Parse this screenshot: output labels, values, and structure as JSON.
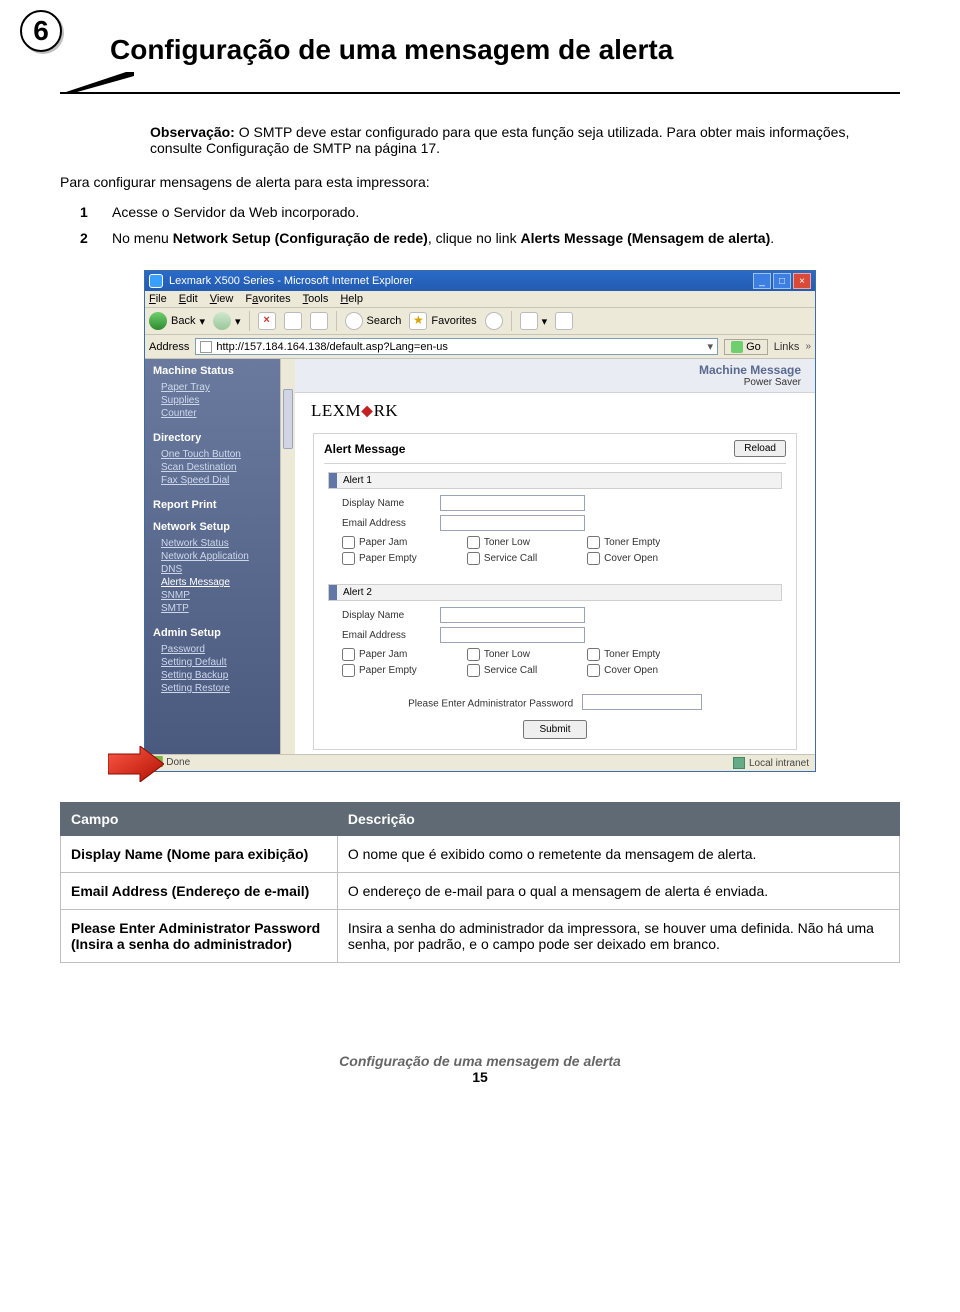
{
  "step_number": "6",
  "page_title": "Configuração de uma mensagem de alerta",
  "note": {
    "label": "Observação:",
    "text": "O SMTP deve estar configurado para que esta função seja utilizada. Para obter mais informações, consulte Configuração de SMTP na página 17."
  },
  "lead": "Para configurar mensagens de alerta para esta impressora:",
  "steps": [
    {
      "num": "1",
      "text": "Acesse o Servidor da Web incorporado."
    },
    {
      "num": "2",
      "text_pre": "No menu ",
      "bold1": "Network Setup (Configuração de rede)",
      "mid": ", clique no link ",
      "bold2": "Alerts Message (Mensagem de alerta)",
      "post": "."
    }
  ],
  "browser": {
    "title": "Lexmark X500 Series - Microsoft Internet Explorer",
    "menus": [
      "File",
      "Edit",
      "View",
      "Favorites",
      "Tools",
      "Help"
    ],
    "toolbar": {
      "back": "Back",
      "search": "Search",
      "favorites": "Favorites"
    },
    "address_label": "Address",
    "url": "http://157.184.164.138/default.asp?Lang=en-us",
    "go": "Go",
    "links": "Links",
    "machine_message": {
      "title": "Machine Message",
      "sub": "Power Saver"
    },
    "brand": "LEXMARK",
    "sidebar": {
      "machine_status": {
        "title": "Machine Status",
        "items": [
          "Paper Tray",
          "Supplies",
          "Counter"
        ]
      },
      "directory": {
        "title": "Directory",
        "items": [
          "One Touch Button",
          "Scan Destination",
          "Fax Speed Dial"
        ]
      },
      "report_print": {
        "title": "Report Print"
      },
      "network_setup": {
        "title": "Network Setup",
        "items": [
          "Network Status",
          "Network Application",
          "DNS",
          "Alerts Message",
          "SNMP",
          "SMTP"
        ]
      },
      "admin_setup": {
        "title": "Admin Setup",
        "items": [
          "Password",
          "Setting Default",
          "Setting Backup",
          "Setting Restore"
        ]
      }
    },
    "panel_title": "Alert Message",
    "reload": "Reload",
    "alert": {
      "group1": "Alert 1",
      "group2": "Alert 2",
      "display_name": "Display Name",
      "email": "Email Address",
      "c_paperjam": "Paper Jam",
      "c_paperempty": "Paper Empty",
      "c_tonerlow": "Toner Low",
      "c_servicecall": "Service Call",
      "c_tonerempty": "Toner Empty",
      "c_coveropen": "Cover Open",
      "admin_prompt": "Please Enter Administrator Password",
      "submit": "Submit"
    },
    "status_done": "Done",
    "status_zone": "Local intranet"
  },
  "table": {
    "col1": "Campo",
    "col2": "Descrição",
    "rows": [
      {
        "k": "Display Name (Nome para exibição)",
        "v": "O nome que é exibido como o remetente da mensagem de alerta."
      },
      {
        "k": "Email Address (Endereço de e-mail)",
        "v": "O endereço de e-mail para o qual a mensagem de alerta é enviada."
      },
      {
        "k": "Please Enter Administrator Password (Insira a senha do administrador)",
        "v": "Insira a senha do administrador da impressora, se houver uma definida. Não há uma senha, por padrão, e o campo pode ser deixado em branco."
      }
    ]
  },
  "footer_title": "Configuração de uma mensagem de alerta",
  "footer_page": "15"
}
